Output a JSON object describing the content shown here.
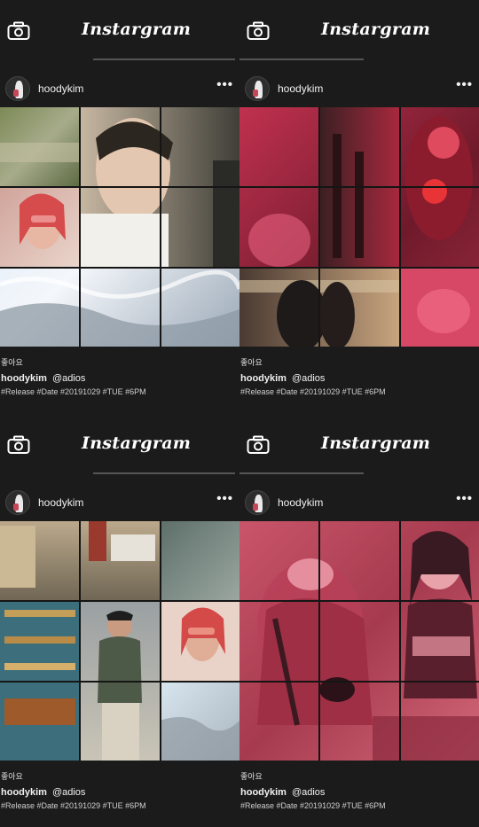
{
  "posts": [
    {
      "brand": "Instargram",
      "username": "hoodykim",
      "likes_label": "좋아요",
      "caption_user": "hoodykim",
      "caption_mention": "@adios",
      "hashtags": "#Release #Date #20191029 #TUE #6PM"
    },
    {
      "brand": "Instargram",
      "username": "hoodykim",
      "likes_label": "좋아요",
      "caption_user": "hoodykim",
      "caption_mention": "@adios",
      "hashtags": "#Release #Date #20191029 #TUE #6PM"
    },
    {
      "brand": "Instargram",
      "username": "hoodykim",
      "likes_label": "좋아요",
      "caption_user": "hoodykim",
      "caption_mention": "@adios",
      "hashtags": "#Release #Date #20191029 #TUE #6PM"
    },
    {
      "brand": "Instargram",
      "username": "hoodykim",
      "likes_label": "좋아요",
      "caption_user": "hoodykim",
      "caption_mention": "@adios",
      "hashtags": "#Release #Date #20191029 #TUE #6PM"
    }
  ],
  "icons": {
    "camera": "camera-icon",
    "more": "more-options-icon",
    "avatar": "avatar-icon"
  },
  "colors": {
    "background": "#1b1b1b",
    "text": "#f2f2f2",
    "pink_tint": "#d8466b"
  }
}
